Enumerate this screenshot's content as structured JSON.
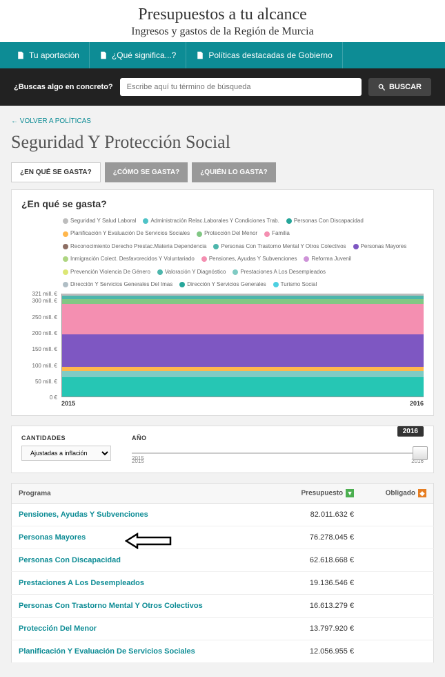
{
  "header": {
    "title": "Presupuestos a tu alcance",
    "subtitle": "Ingresos y gastos de la Región de Murcia"
  },
  "nav": {
    "items": [
      "Tu aportación",
      "¿Qué significa...?",
      "Políticas destacadas de Gobierno"
    ]
  },
  "search": {
    "label": "¿Buscas algo en concreto?",
    "placeholder": "Escribe aquí tu término de búsqueda",
    "button": "BUSCAR"
  },
  "back_link": "← VOLVER A POLÍTICAS",
  "page_title": "Seguridad Y Protección Social",
  "tabs": {
    "t1": "¿EN QUÉ SE GASTA?",
    "t2": "¿CÓMO SE GASTA?",
    "t3": "¿QUIÉN LO GASTA?"
  },
  "panel_title": "¿En qué se gasta?",
  "chart_data": {
    "type": "area",
    "title": "",
    "xlabel": "",
    "ylabel": "",
    "x": [
      "2015",
      "2016"
    ],
    "ylim": [
      0,
      321
    ],
    "y_ticks": [
      "321 mill. €",
      "300 mill. €",
      "250 mill. €",
      "200 mill. €",
      "150 mill. €",
      "100 mill. €",
      "50 mill. €",
      "0 €"
    ],
    "series": [
      {
        "name": "Seguridad Y Salud Laboral",
        "values": [
          2,
          2
        ],
        "color": "#bdbdbd"
      },
      {
        "name": "Administración Relac.Laborales Y Condiciones Trab.",
        "values": [
          2,
          2
        ],
        "color": "#4fc3c7"
      },
      {
        "name": "Personas Con Discapacidad",
        "values": [
          60,
          62
        ],
        "color": "#26a69a"
      },
      {
        "name": "Planificación Y Evaluación De Servicios Sociales",
        "values": [
          11,
          12
        ],
        "color": "#ffb74d"
      },
      {
        "name": "Protección Del Menor",
        "values": [
          13,
          13
        ],
        "color": "#81c784"
      },
      {
        "name": "Familia",
        "values": [
          3,
          3
        ],
        "color": "#f48fb1"
      },
      {
        "name": "Reconocimiento Derecho Prestac.Materia Dependencia",
        "values": [
          2,
          2
        ],
        "color": "#8d6e63"
      },
      {
        "name": "Personas Con Trastorno Mental Y Otros Colectivos",
        "values": [
          15,
          16
        ],
        "color": "#4db6ac"
      },
      {
        "name": "Personas Mayores",
        "values": [
          72,
          76
        ],
        "color": "#7e57c2"
      },
      {
        "name": "Inmigración Colect. Desfavorecidos Y Voluntariado",
        "values": [
          2,
          2
        ],
        "color": "#aed581"
      },
      {
        "name": "Pensiones, Ayudas Y Subvenciones",
        "values": [
          78,
          82
        ],
        "color": "#f48fb1"
      },
      {
        "name": "Reforma Juvenil",
        "values": [
          3,
          3
        ],
        "color": "#ce93d8"
      },
      {
        "name": "Prevención Violencia De Género",
        "values": [
          2,
          2
        ],
        "color": "#dce775"
      },
      {
        "name": "Valoración Y Diagnóstico",
        "values": [
          2,
          2
        ],
        "color": "#4db6ac"
      },
      {
        "name": "Prestaciones A Los Desempleados",
        "values": [
          18,
          19
        ],
        "color": "#80cbc4"
      },
      {
        "name": "Dirección Y Servicios Generales Del Imas",
        "values": [
          2,
          2
        ],
        "color": "#b0bec5"
      },
      {
        "name": "Dirección Y Servicios Generales",
        "values": [
          2,
          2
        ],
        "color": "#26a69a"
      },
      {
        "name": "Turismo Social",
        "values": [
          2,
          2
        ],
        "color": "#4dd0e1"
      }
    ],
    "stacked_bands": [
      {
        "color": "#26c6b4",
        "from": 0,
        "to": 62
      },
      {
        "color": "#80cbc4",
        "from": 62,
        "to": 82
      },
      {
        "color": "#ffb74d",
        "from": 82,
        "to": 95
      },
      {
        "color": "#7e57c2",
        "from": 95,
        "to": 195
      },
      {
        "color": "#f48fb1",
        "from": 195,
        "to": 290
      },
      {
        "color": "#81c784",
        "from": 290,
        "to": 305
      },
      {
        "color": "#4db6ac",
        "from": 305,
        "to": 316
      },
      {
        "color": "#bdbdbd",
        "from": 316,
        "to": 321
      }
    ]
  },
  "controls": {
    "cantidades_label": "CANTIDADES",
    "cantidades_value": "Ajustadas a inflación",
    "ano_label": "AÑO",
    "year_start": "2015",
    "year_end": "2016",
    "year_selected": "2016"
  },
  "table": {
    "headers": {
      "programa": "Programa",
      "presupuesto": "Presupuesto",
      "obligado": "Obligado"
    },
    "rows": [
      {
        "name": "Pensiones, Ayudas Y Subvenciones",
        "presupuesto": "82.011.632 €",
        "obligado": ""
      },
      {
        "name": "Personas Mayores",
        "presupuesto": "76.278.045 €",
        "obligado": ""
      },
      {
        "name": "Personas Con Discapacidad",
        "presupuesto": "62.618.668 €",
        "obligado": ""
      },
      {
        "name": "Prestaciones A Los Desempleados",
        "presupuesto": "19.136.546 €",
        "obligado": ""
      },
      {
        "name": "Personas Con Trastorno Mental Y Otros Colectivos",
        "presupuesto": "16.613.279 €",
        "obligado": ""
      },
      {
        "name": "Protección Del Menor",
        "presupuesto": "13.797.920 €",
        "obligado": ""
      },
      {
        "name": "Planificación Y Evaluación De Servicios Sociales",
        "presupuesto": "12.056.955 €",
        "obligado": ""
      }
    ]
  }
}
